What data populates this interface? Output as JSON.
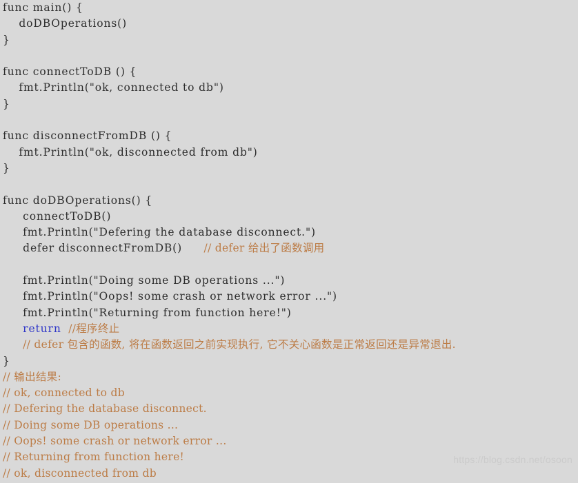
{
  "editor": {
    "background_color": "#d9d9d9",
    "code_color": "#2d2d2d",
    "comment_color": "#bc7c46",
    "keyword_color": "#2f36c8",
    "watermark_color": "#cbcbcb",
    "language": "Go"
  },
  "watermark": {
    "text": "https://blog.csdn.net/osoon"
  },
  "code": {
    "lines": [
      {
        "indent": "",
        "code": "func main() {",
        "comment": ""
      },
      {
        "indent": "    ",
        "code": "doDBOperations()",
        "comment": ""
      },
      {
        "indent": "",
        "code": "}",
        "comment": ""
      },
      {
        "indent": "",
        "code": "",
        "comment": ""
      },
      {
        "indent": "",
        "code": "func connectToDB () {",
        "comment": ""
      },
      {
        "indent": "    ",
        "code": "fmt.Println(\"ok, connected to db\")",
        "comment": ""
      },
      {
        "indent": "",
        "code": "}",
        "comment": ""
      },
      {
        "indent": "",
        "code": "",
        "comment": ""
      },
      {
        "indent": "",
        "code": "func disconnectFromDB () {",
        "comment": ""
      },
      {
        "indent": "    ",
        "code": "fmt.Println(\"ok, disconnected from db\")",
        "comment": ""
      },
      {
        "indent": "",
        "code": "}",
        "comment": ""
      },
      {
        "indent": "",
        "code": "",
        "comment": ""
      },
      {
        "indent": "",
        "code": "func doDBOperations() {",
        "comment": ""
      },
      {
        "indent": "     ",
        "code": "connectToDB()",
        "comment": ""
      },
      {
        "indent": "     ",
        "code": "fmt.Println(\"Defering the database disconnect.\")",
        "comment": ""
      },
      {
        "indent": "     ",
        "code": "defer disconnectFromDB()",
        "comment": "      // defer 给出了函数调用"
      },
      {
        "indent": "",
        "code": "",
        "comment": ""
      },
      {
        "indent": "     ",
        "code": "fmt.Println(\"Doing some DB operations ...\")",
        "comment": ""
      },
      {
        "indent": "     ",
        "code": "fmt.Println(\"Oops! some crash or network error ...\")",
        "comment": ""
      },
      {
        "indent": "     ",
        "code": "fmt.Println(\"Returning from function here!\")",
        "comment": ""
      }
    ],
    "return_line": {
      "indent": "     ",
      "keyword": "return",
      "comment": "  //程序终止"
    },
    "defer_note_line": {
      "indent": "     ",
      "comment": "// defer 包含的函数, 将在函数返回之前实现执行, 它不关心函数是正常返回还是异常退出."
    },
    "close_brace_line": {
      "indent": "",
      "code": "}"
    },
    "output_comment_lines": [
      "// 输出结果:",
      "// ok, connected to db",
      "// Defering the database disconnect.",
      "// Doing some DB operations ...",
      "// Oops! some crash or network error ...",
      "// Returning from function here!",
      "// ok, disconnected from db"
    ]
  }
}
